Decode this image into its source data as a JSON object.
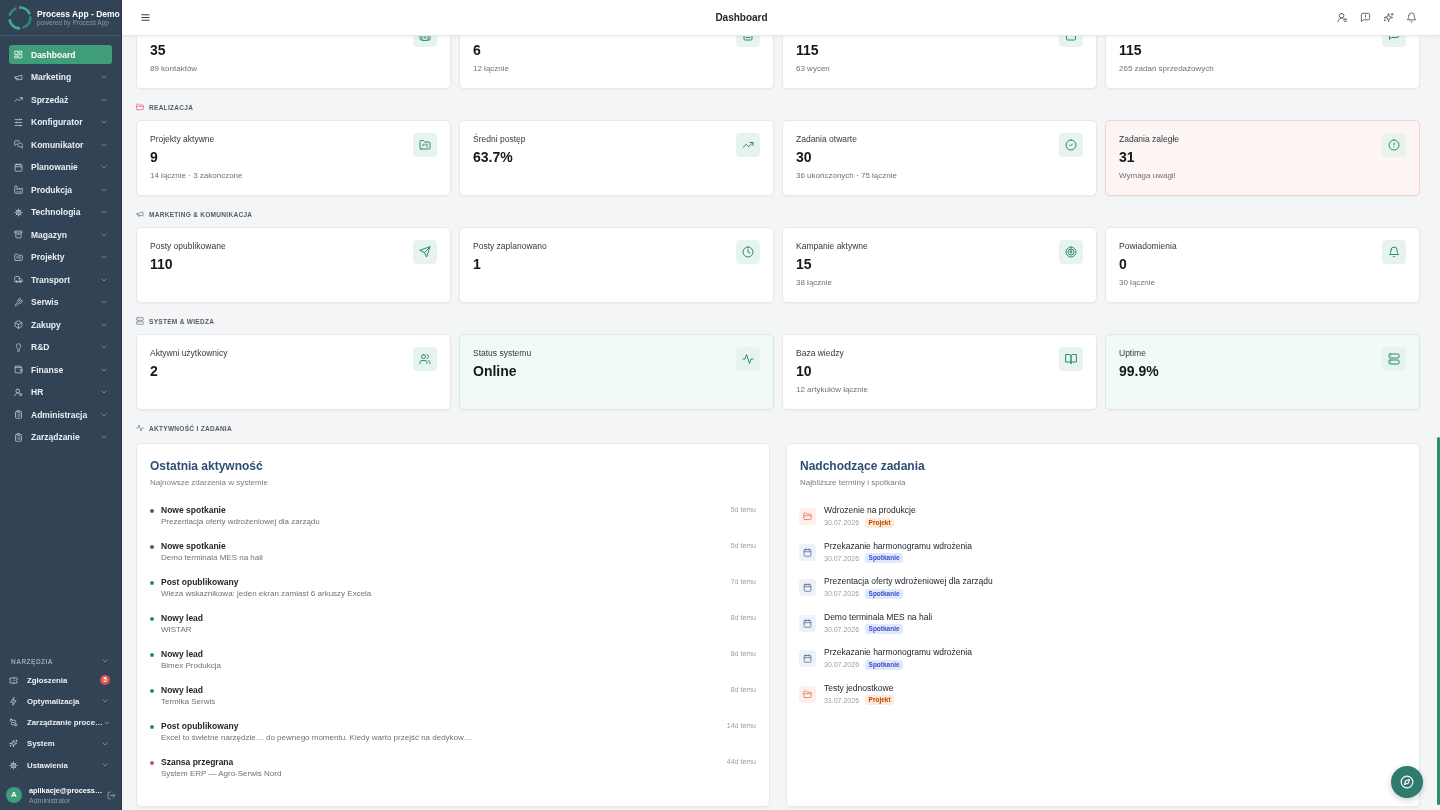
{
  "sidebar": {
    "app_title": "Process App - Demo",
    "app_subtitle": "powered by Process App",
    "items": [
      {
        "label": "Dashboard",
        "selected": true,
        "expandable": false
      },
      {
        "label": "Marketing",
        "selected": false,
        "expandable": true
      },
      {
        "label": "Sprzedaż",
        "selected": false,
        "expandable": true
      },
      {
        "label": "Konfigurator",
        "selected": false,
        "expandable": true
      },
      {
        "label": "Komunikator",
        "selected": false,
        "expandable": true
      },
      {
        "label": "Planowanie",
        "selected": false,
        "expandable": true
      },
      {
        "label": "Produkcja",
        "selected": false,
        "expandable": true
      },
      {
        "label": "Technologia",
        "selected": false,
        "expandable": true
      },
      {
        "label": "Magazyn",
        "selected": false,
        "expandable": true
      },
      {
        "label": "Projekty",
        "selected": false,
        "expandable": true
      },
      {
        "label": "Transport",
        "selected": false,
        "expandable": true
      },
      {
        "label": "Serwis",
        "selected": false,
        "expandable": true
      },
      {
        "label": "Zakupy",
        "selected": false,
        "expandable": true
      },
      {
        "label": "R&D",
        "selected": false,
        "expandable": true
      },
      {
        "label": "Finanse",
        "selected": false,
        "expandable": true
      },
      {
        "label": "HR",
        "selected": false,
        "expandable": true
      },
      {
        "label": "Administracja",
        "selected": false,
        "expandable": true
      },
      {
        "label": "Zarządzanie",
        "selected": false,
        "expandable": true
      }
    ],
    "tools": {
      "title": "NARZĘDZIA",
      "collapsible": true,
      "items": [
        {
          "label": "Zgłoszenia",
          "selected": false,
          "expandable": false,
          "badge": "5"
        },
        {
          "label": "Optymalizacja",
          "selected": false,
          "expandable": true
        },
        {
          "label": "Zarządzanie proce…",
          "selected": false,
          "expandable": true
        },
        {
          "label": "System",
          "selected": false,
          "expandable": true
        },
        {
          "label": "Ustawienia",
          "selected": false,
          "expandable": true
        }
      ]
    },
    "user": {
      "initial": "A",
      "name": "aplikacje@process…",
      "role": "Administrator"
    }
  },
  "topbar": {
    "title": "Dashboard"
  },
  "top_stats": [
    {
      "value": "35",
      "caption": "89 kontaktów"
    },
    {
      "value": "6",
      "caption": "12 łącznie"
    },
    {
      "value": "115",
      "caption": "63 wycen"
    },
    {
      "value": "115",
      "caption": "265 zadań sprzedażowych"
    }
  ],
  "sections": [
    {
      "title": "REALIZACJA",
      "cards": [
        {
          "label": "Projekty aktywne",
          "value": "9",
          "caption": "14 łącznie · 3 zakończone",
          "kind": "plain"
        },
        {
          "label": "Średni postęp",
          "value": "63.7%",
          "kind": "plain"
        },
        {
          "label": "Zadania otwarte",
          "value": "30",
          "caption": "36 ukończonych · 75 łącznie",
          "kind": "plain"
        },
        {
          "label": "Zadania zaległe",
          "value": "31",
          "caption": "Wymaga uwagi!",
          "kind": "alert"
        }
      ]
    },
    {
      "title": "MARKETING & KOMUNIKACJA",
      "cards": [
        {
          "label": "Posty opublikowane",
          "value": "110",
          "kind": "plain"
        },
        {
          "label": "Posty zaplanowano",
          "value": "1",
          "kind": "plain"
        },
        {
          "label": "Kampanie aktywne",
          "value": "15",
          "caption": "38 łącznie",
          "kind": "plain"
        },
        {
          "label": "Powiadomienia",
          "value": "0",
          "caption": "30 łącznie",
          "kind": "plain"
        }
      ]
    },
    {
      "title": "SYSTEM & WIEDZA",
      "cards": [
        {
          "label": "Aktywni użytkownicy",
          "value": "2",
          "kind": "plain"
        },
        {
          "label": "Status systemu",
          "value": "Online",
          "kind": "success"
        },
        {
          "label": "Baza wiedzy",
          "value": "10",
          "caption": "12 artykułów łącznie",
          "kind": "plain"
        },
        {
          "label": "Uptime",
          "value": "99.9%",
          "kind": "success"
        }
      ]
    }
  ],
  "activity_section": {
    "title": "AKTYWNOŚĆ I ZADANIA"
  },
  "recent_activity": {
    "title": "Ostatnia aktywność",
    "subtitle": "Najnowsze zdarzenia w systemie",
    "items": [
      {
        "title": "Nowe spotkanie",
        "description": "Prezentacja oferty wdrożeniowej dla zarządu",
        "time": "5d temu",
        "color": "#4b5d7d"
      },
      {
        "title": "Nowe spotkanie",
        "description": "Demo terminala MES na hali",
        "time": "5d temu",
        "color": "#4b5d7d"
      },
      {
        "title": "Post opublikowany",
        "description": "Wieza wskaznikowa: jeden ekran zamiast 6 arkuszy Excela",
        "time": "7d temu",
        "color": "#2e8b6a"
      },
      {
        "title": "Nowy lead",
        "description": "WISTAR",
        "time": "8d temu",
        "color": "#2e8b6a"
      },
      {
        "title": "Nowy lead",
        "description": "Bimex Produkcja",
        "time": "8d temu",
        "color": "#2e8b6a"
      },
      {
        "title": "Nowy lead",
        "description": "Termika Serwis",
        "time": "8d temu",
        "color": "#2e8b6a"
      },
      {
        "title": "Post opublikowany",
        "description": "Excel to świetne narzędzie… do pewnego momentu. Kiedy warto przejść na dedykow…",
        "time": "14d temu",
        "color": "#2e8b6a"
      },
      {
        "title": "Szansa przegrana",
        "description": "System ERP — Agro-Serwis Nord",
        "time": "44d temu",
        "color": "#c0574f"
      }
    ]
  },
  "upcoming_tasks": {
    "title": "Nadchodzące zadania",
    "subtitle": "Najbliższe terminy i spotkania",
    "items": [
      {
        "title": "Wdrozenie na produkcje",
        "date": "30.07.2026",
        "tag": "Projekt",
        "kind": "project"
      },
      {
        "title": "Przekazanie harmonogramu wdrożenia",
        "date": "30.07.2026",
        "tag": "Spotkanie",
        "kind": "meeting"
      },
      {
        "title": "Prezentacja oferty wdrożeniowej dla zarządu",
        "date": "30.07.2026",
        "tag": "Spotkanie",
        "kind": "meeting"
      },
      {
        "title": "Demo terminala MES na hali",
        "date": "30.07.2026",
        "tag": "Spotkanie",
        "kind": "meeting"
      },
      {
        "title": "Przekazanie harmonogramu wdrożenia",
        "date": "30.07.2026",
        "tag": "Spotkanie",
        "kind": "meeting"
      },
      {
        "title": "Testy jednostkowe",
        "date": "31.07.2026",
        "tag": "Projekt",
        "kind": "project"
      }
    ]
  }
}
